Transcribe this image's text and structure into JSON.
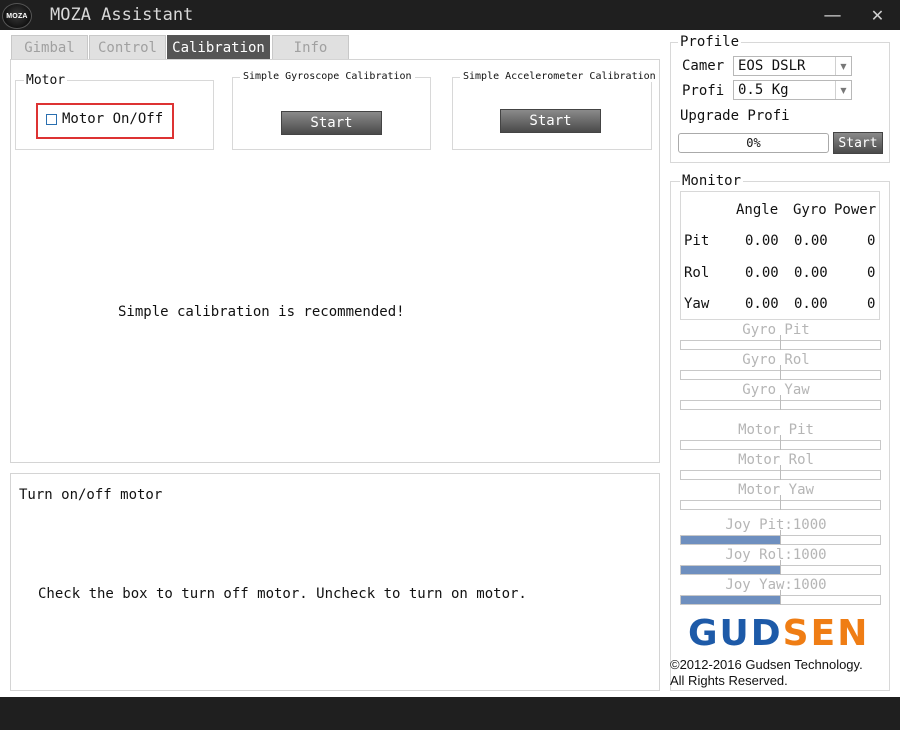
{
  "window": {
    "logo_text": "MOZA",
    "title": "MOZA Assistant",
    "minimize_glyph": "—",
    "close_glyph": "✕"
  },
  "tabs": [
    {
      "label": "Gimbal",
      "active": false
    },
    {
      "label": "Control",
      "active": false
    },
    {
      "label": "Calibration",
      "active": true
    },
    {
      "label": "Info",
      "active": false
    }
  ],
  "calibration": {
    "motor_group_title": "Motor",
    "motor_checkbox_label": "Motor On/Off",
    "motor_checked": false,
    "gyro_title": "Simple Gyroscope Calibration",
    "gyro_button": "Start",
    "accel_title": "Simple Accelerometer Calibration",
    "accel_button": "Start",
    "message": "Simple calibration is recommended!"
  },
  "help": {
    "title": "Turn on/off motor",
    "text": "Check the box to turn off motor. Uncheck to turn on motor."
  },
  "profile": {
    "title": "Profile",
    "camera_label": "Camer",
    "camera_value": "EOS DSLR",
    "profile_label": "Profi",
    "profile_value": "0.5 Kg",
    "upgrade_label": "Upgrade Profi",
    "progress_text": "0%",
    "progress_value": 0,
    "start_button": "Start"
  },
  "monitor": {
    "title": "Monitor",
    "headers": [
      "Angle",
      "Gyro",
      "Power"
    ],
    "rows": [
      {
        "label": "Pit",
        "angle": "0.00",
        "gyro": "0.00",
        "power": "0"
      },
      {
        "label": "Rol",
        "angle": "0.00",
        "gyro": "0.00",
        "power": "0"
      },
      {
        "label": "Yaw",
        "angle": "0.00",
        "gyro": "0.00",
        "power": "0"
      }
    ],
    "bars": [
      {
        "label": "Gyro Pit",
        "fill": 0
      },
      {
        "label": "Gyro Rol",
        "fill": 0
      },
      {
        "label": "Gyro Yaw",
        "fill": 0
      },
      {
        "label": "Motor Pit",
        "fill": 0
      },
      {
        "label": "Motor Rol",
        "fill": 0
      },
      {
        "label": "Motor Yaw",
        "fill": 0
      },
      {
        "label": "Joy Pit:1000",
        "fill": 0.5
      },
      {
        "label": "Joy Rol:1000",
        "fill": 0.5
      },
      {
        "label": "Joy Yaw:1000",
        "fill": 0.5
      }
    ]
  },
  "branding": {
    "logo_part1": "GUD",
    "logo_part2": "SEN",
    "copyright_line1": "©2012-2016 Gudsen Technology.",
    "copyright_line2": "All Rights Reserved.",
    "color_blue": "#1d5aa8",
    "color_orange": "#ef7d14"
  }
}
